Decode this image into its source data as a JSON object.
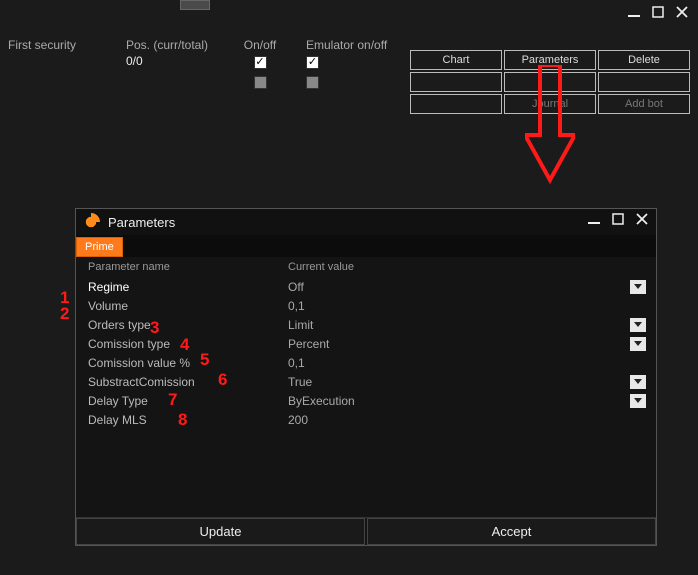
{
  "topbar": {
    "handle": true
  },
  "header": {
    "col1": "First security",
    "col2": "Pos. (curr/total)",
    "col3": "On/off",
    "col4": "Emulator on/off",
    "posvalue": "0/0"
  },
  "buttons": {
    "r1c1": "Chart",
    "r1c2": "Parameters",
    "r1c3": "Delete",
    "r2c1": "",
    "r2c2": "",
    "r2c3": "",
    "r3c1": "",
    "r3c2": "Journal",
    "r3c3": "Add bot"
  },
  "dialog": {
    "title": "Parameters",
    "tab": "Prime",
    "grid": {
      "h1": "Parameter name",
      "h2": "Current value"
    },
    "rows": [
      {
        "name": "Regime",
        "value": "Off",
        "dd": true,
        "hl": true
      },
      {
        "name": "Volume",
        "value": "0,1",
        "dd": false
      },
      {
        "name": "Orders type",
        "value": "Limit",
        "dd": true
      },
      {
        "name": "Comission type",
        "value": "Percent",
        "dd": true
      },
      {
        "name": "Comission value %",
        "value": "0,1",
        "dd": false
      },
      {
        "name": "SubstractComission",
        "value": "True",
        "dd": true
      },
      {
        "name": "Delay Type",
        "value": "ByExecution",
        "dd": true
      },
      {
        "name": "Delay MLS",
        "value": "200",
        "dd": false
      }
    ],
    "footer": {
      "update": "Update",
      "accept": "Accept"
    }
  },
  "annotations": [
    "1",
    "2",
    "3",
    "4",
    "5",
    "6",
    "7",
    "8"
  ]
}
